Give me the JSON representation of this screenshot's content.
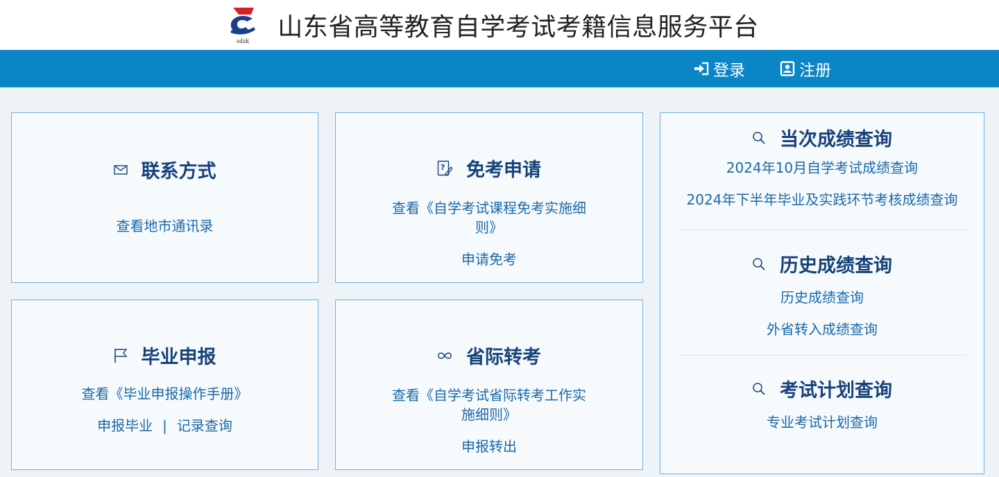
{
  "header": {
    "title": "山东省高等教育自学考试考籍信息服务平台",
    "logo_text": "sdzk"
  },
  "nav": {
    "login": "登录",
    "register": "注册"
  },
  "cards": {
    "contact": {
      "title": "联系方式",
      "link1": "查看地市通讯录"
    },
    "exempt": {
      "title": "免考申请",
      "link1_line1": "查看《自学考试课程免考实施细",
      "link1_line2": "则》",
      "link2": "申请免考"
    },
    "graduation": {
      "title": "毕业申报",
      "link1": "查看《毕业申报操作手册》",
      "link2": "申报毕业",
      "separator": "|",
      "link3": "记录查询"
    },
    "transfer": {
      "title": "省际转考",
      "link1_line1": "查看《自学考试省际转考工作实",
      "link1_line2": "施细则》",
      "link2": "申报转出"
    },
    "scores": {
      "current_title": "当次成绩查询",
      "current_link1": "2024年10月自学考试成绩查询",
      "current_link2": "2024年下半年毕业及实践环节考核成绩查询",
      "history_title": "历史成绩查询",
      "history_link1": "历史成绩查询",
      "history_link2": "外省转入成绩查询",
      "plan_title": "考试计划查询",
      "plan_link1": "专业考试计划查询"
    }
  },
  "colors": {
    "nav_bg": "#0a85c6",
    "card_title": "#16427a",
    "link": "#1a68a8",
    "card_border": "#6cb3e0"
  }
}
